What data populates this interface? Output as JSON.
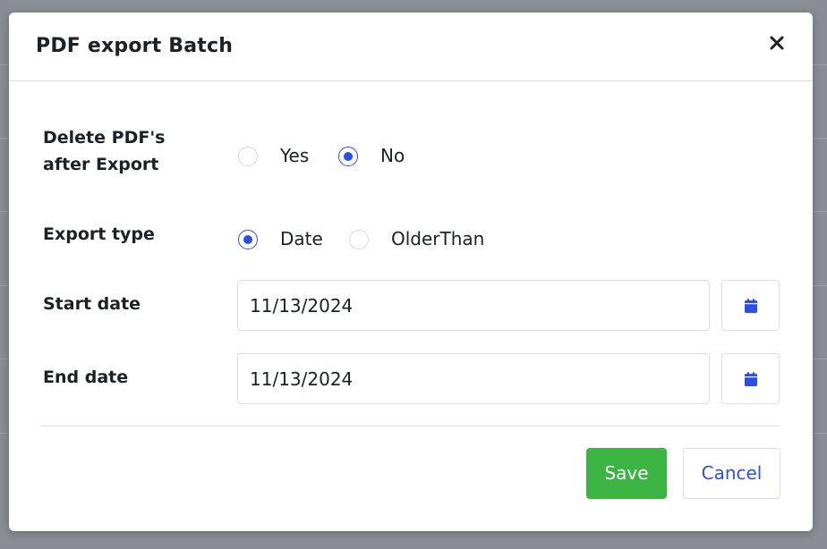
{
  "dialog": {
    "title": "PDF export Batch",
    "close_icon": "close-icon"
  },
  "delete_pdfs": {
    "label_line1": "Delete PDF's",
    "label_line2": "after Export",
    "options": [
      {
        "label": "Yes",
        "checked": false
      },
      {
        "label": "No",
        "checked": true
      }
    ]
  },
  "export_type": {
    "label": "Export type",
    "options": [
      {
        "label": "Date",
        "checked": true
      },
      {
        "label": "OlderThan",
        "checked": false
      }
    ]
  },
  "start_date": {
    "label": "Start date",
    "value": "11/13/2024",
    "picker_icon": "calendar-icon"
  },
  "end_date": {
    "label": "End date",
    "value": "11/13/2024",
    "picker_icon": "calendar-icon"
  },
  "footer": {
    "save_label": "Save",
    "cancel_label": "Cancel"
  },
  "colors": {
    "accent": "#2f4fe0",
    "save": "#3cb444",
    "backdrop": "#8a8d93"
  }
}
